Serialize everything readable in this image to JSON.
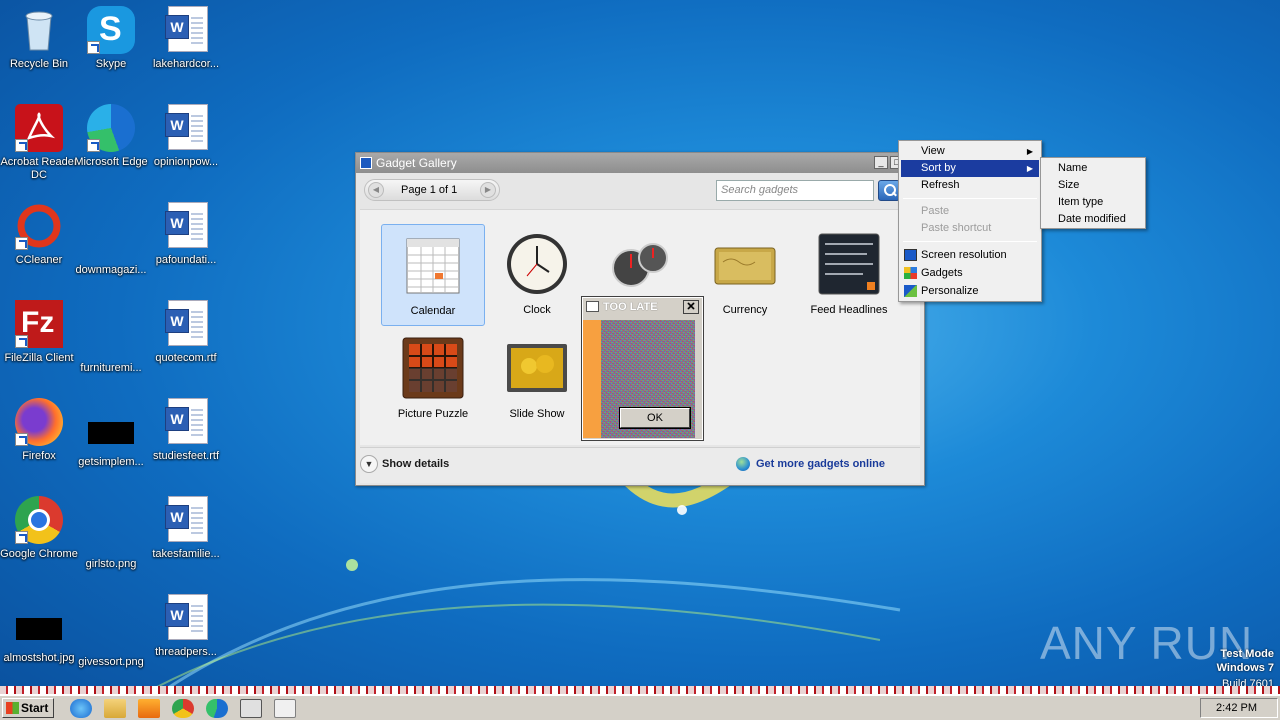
{
  "desktop": {
    "icons": [
      {
        "label": "Recycle Bin"
      },
      {
        "label": "Skype"
      },
      {
        "label": "lakehardcor..."
      },
      {
        "label": "Acrobat Reader DC"
      },
      {
        "label": "Microsoft Edge"
      },
      {
        "label": "opinionpow..."
      },
      {
        "label": "CCleaner"
      },
      {
        "label": "downmagazi..."
      },
      {
        "label": "pafoundati..."
      },
      {
        "label": "FileZilla Client"
      },
      {
        "label": "furnituremi..."
      },
      {
        "label": "quotecom.rtf"
      },
      {
        "label": "Firefox"
      },
      {
        "label": "getsimplem..."
      },
      {
        "label": "studiesfeet.rtf"
      },
      {
        "label": "Google Chrome"
      },
      {
        "label": "girlsto.png"
      },
      {
        "label": "takesfamilie..."
      },
      {
        "label": "almostshot.jpg"
      },
      {
        "label": "givessort.png"
      },
      {
        "label": "threadpers..."
      }
    ]
  },
  "gadget_gallery": {
    "title": "Gadget Gallery",
    "page_label": "Page 1 of 1",
    "search_placeholder": "Search gadgets",
    "gadgets": [
      {
        "name": "Calendar",
        "selected": true
      },
      {
        "name": "Clock"
      },
      {
        "name": ""
      },
      {
        "name": "Currency"
      },
      {
        "name": "Feed Headlines"
      },
      {
        "name": "Picture Puzzle"
      },
      {
        "name": "Slide Show"
      }
    ],
    "show_details": "Show details",
    "get_more": "Get more gadgets online"
  },
  "alert_dialog": {
    "title": "TOO LATE",
    "ok_label": "OK"
  },
  "context_menu": {
    "items": [
      {
        "label": "View",
        "submenu": true
      },
      {
        "label": "Sort by",
        "submenu": true,
        "highlighted": true
      },
      {
        "label": "Refresh"
      },
      {
        "label": "Paste",
        "disabled": true
      },
      {
        "label": "Paste shortcut",
        "disabled": true
      },
      {
        "label": "Screen resolution",
        "icon": "monitor-icon"
      },
      {
        "label": "Gadgets",
        "icon": "gadgets-icon"
      },
      {
        "label": "Personalize",
        "icon": "personalize-icon"
      }
    ],
    "sort_submenu": [
      {
        "label": "Name"
      },
      {
        "label": "Size"
      },
      {
        "label": "Item type"
      },
      {
        "label": "Date modified"
      }
    ]
  },
  "watermark": {
    "text": "ANY RUN",
    "mode_line1": "Test Mode",
    "mode_line2": "Windows 7",
    "build": "Build 7601"
  },
  "taskbar": {
    "start_label": "Start",
    "clock": "2:42 PM"
  },
  "colors": {
    "menu_highlight": "#1b3ca0",
    "link_blue": "#1a3b9a",
    "desktop_blue": "#1d8ad8"
  }
}
